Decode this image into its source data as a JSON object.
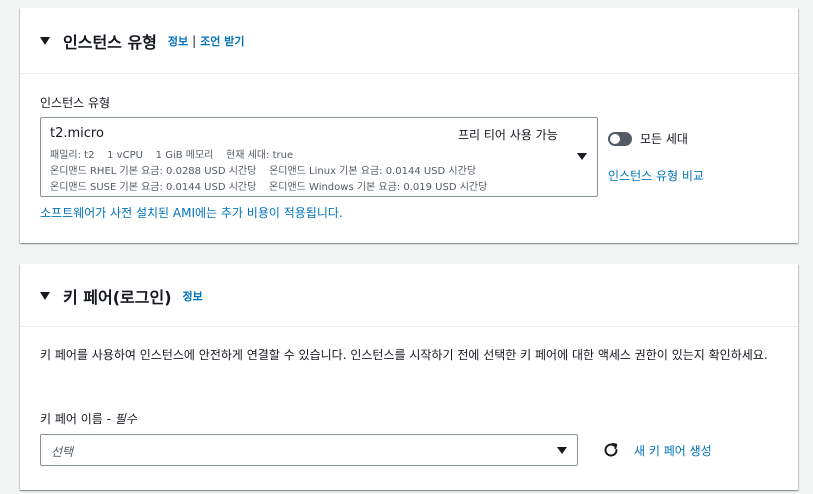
{
  "instance_panel": {
    "title": "인스턴스 유형",
    "info_link": "정보",
    "separator": "|",
    "advice_link": "조언 받기",
    "field_label": "인스턴스 유형",
    "selected": {
      "name": "t2.micro",
      "free_tier": "프리 티어 사용 가능",
      "line1": "패밀리: t2    1 vCPU    1 GiB 메모리    현재 세대: true",
      "line2": "온디맨드 RHEL 기본 요금: 0.0288 USD 시간당    온디맨드 Linux 기본 요금: 0.0144 USD 시간당",
      "line3": "온디맨드 SUSE 기본 요금: 0.0144 USD 시간당    온디맨드 Windows 기본 요금: 0.019 USD 시간당"
    },
    "toggle_label": "모든 세대",
    "toggle_on": false,
    "compare_link": "인스턴스 유형 비교",
    "ami_note_link": "소프트웨어가 사전 설치된 AMI에는 추가 비용이 적용됩니다."
  },
  "keypair_panel": {
    "title": "키 페어(로그인)",
    "info_link": "정보",
    "description": "키 페어를 사용하여 인스턴스에 안전하게 연결할 수 있습니다. 인스턴스를 시작하기 전에 선택한 키 페어에 대한 액세스 권한이 있는지 확인하세요.",
    "field_label": "키 페어 이름 - ",
    "required_text": "필수",
    "select_placeholder": "선택",
    "create_link": "새 키 페어 생성"
  },
  "colors": {
    "link": "#0073bb",
    "text": "#16191f",
    "secondary_text": "#545b64",
    "border": "#879596",
    "background": "#f2f3f3"
  },
  "icons": [
    "caret-down-icon",
    "dropdown-arrow-icon",
    "toggle-switch",
    "refresh-icon"
  ]
}
